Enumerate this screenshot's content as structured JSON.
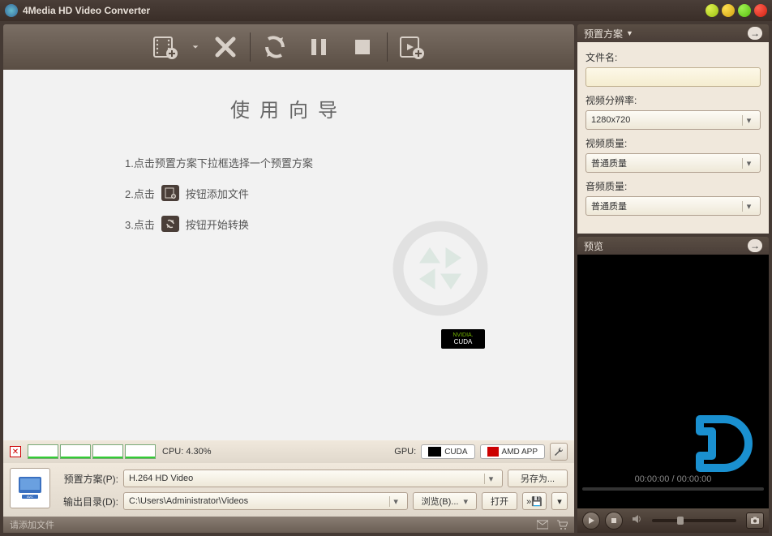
{
  "title": "4Media HD Video Converter",
  "guide": {
    "title": "使用向导",
    "step1": "1.点击预置方案下拉框选择一个预置方案",
    "step2a": "2.点击",
    "step2b": "按钮添加文件",
    "step3a": "3.点击",
    "step3b": "按钮开始转换"
  },
  "status": {
    "cpu_label": "CPU: 4.30%",
    "gpu_label": "GPU:",
    "cuda": "CUDA",
    "amd": "AMD APP"
  },
  "output": {
    "preset_label": "预置方案(P):",
    "preset_value": "H.264 HD Video",
    "saveas": "另存为...",
    "dir_label": "输出目录(D):",
    "dir_value": "C:\\Users\\Administrator\\Videos",
    "browse": "浏览(B)...",
    "open": "打开"
  },
  "footer": {
    "hint": "请添加文件"
  },
  "preset_panel": {
    "header": "预置方案",
    "filename_label": "文件名:",
    "filename_value": "",
    "resolution_label": "视频分辨率:",
    "resolution_value": "1280x720",
    "vquality_label": "视频质量:",
    "vquality_value": "普通质量",
    "aquality_label": "音频质量:",
    "aquality_value": "普通质量"
  },
  "preview_panel": {
    "header": "预览",
    "time": "00:00:00 / 00:00:00"
  },
  "nvidia": {
    "brand": "NVIDIA.",
    "cuda": "CUDA"
  }
}
